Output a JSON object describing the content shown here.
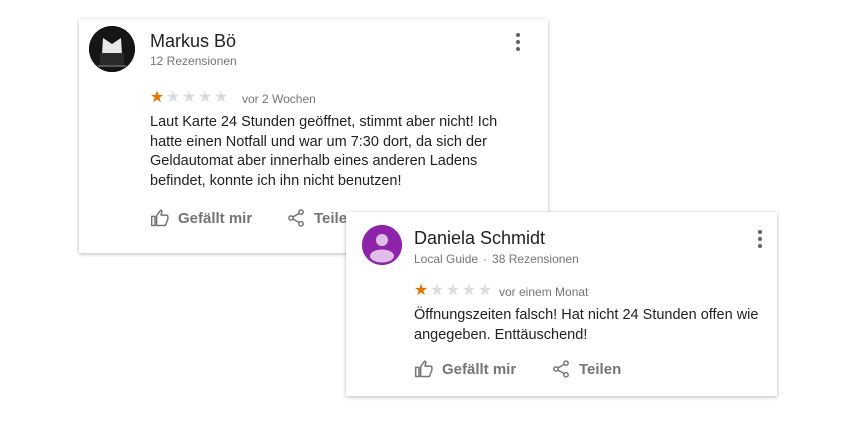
{
  "colors": {
    "star_filled": "#e37400",
    "star_empty": "#dadce0",
    "avatar_purple": "#8e24aa"
  },
  "reviews": [
    {
      "author": "Markus Bö",
      "meta": "12 Rezensionen",
      "rating": 1,
      "max_rating": 5,
      "time": "vor 2 Wochen",
      "text": "Laut Karte 24 Stunden geöffnet, stimmt aber nicht! Ich hatte einen Notfall und war um 7:30 dort, da sich der Geldautomat aber innerhalb eines anderen Ladens befindet, konnte ich ihn nicht benutzen!",
      "like_label": "Gefällt mir",
      "share_label": "Teilen",
      "menu_icon": "more-vert-icon"
    },
    {
      "author": "Daniela Schmidt",
      "local_guide": "Local Guide",
      "meta": "38 Rezensionen",
      "rating": 1,
      "max_rating": 5,
      "time": "vor einem Monat",
      "text": "Öffnungszeiten falsch! Hat nicht 24 Stunden offen wie angegeben. Enttäuschend!",
      "like_label": "Gefällt mir",
      "share_label": "Teilen",
      "menu_icon": "more-vert-icon"
    }
  ]
}
